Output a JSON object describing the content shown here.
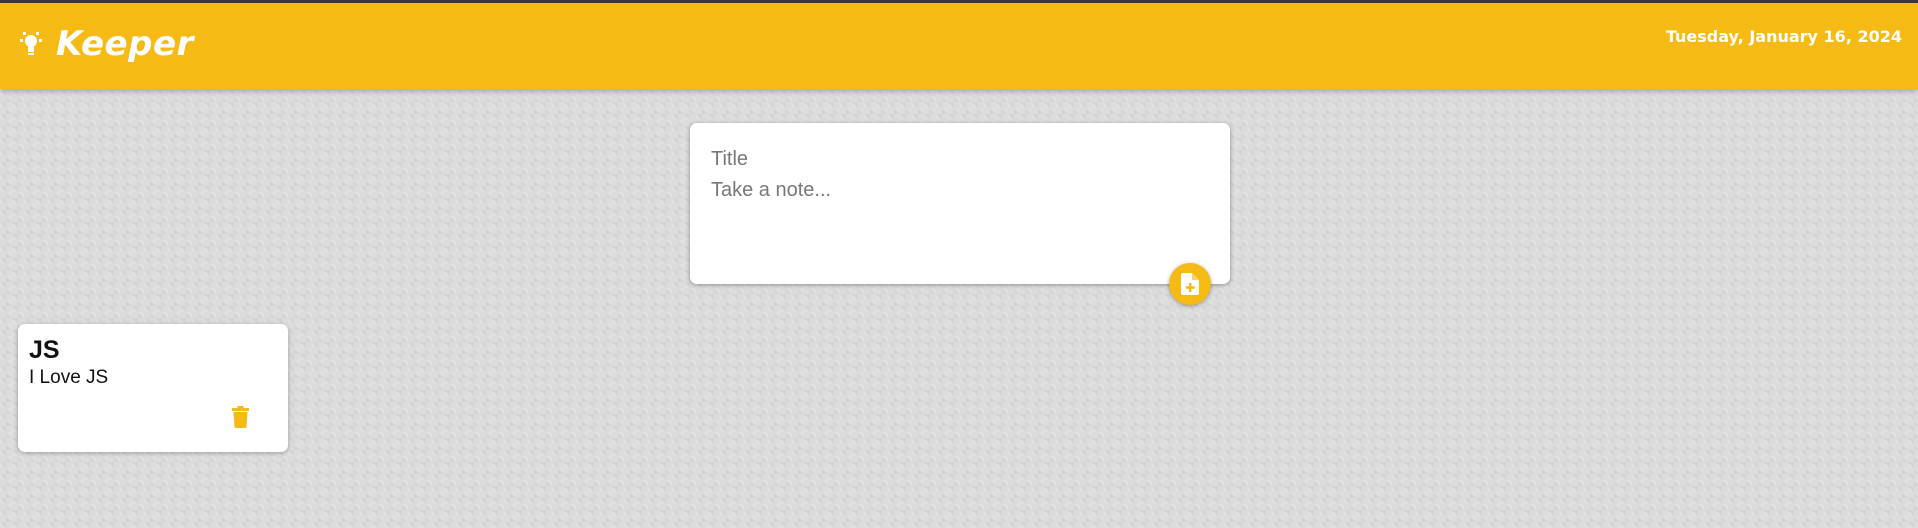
{
  "header": {
    "app_title": "Keeper",
    "logo_icon": "lightbulb-icon",
    "date": "Tuesday, January 16, 2024"
  },
  "create_note": {
    "title_placeholder": "Title",
    "content_placeholder": "Take a note...",
    "title_value": "",
    "content_value": "",
    "add_button_icon": "note-add-icon"
  },
  "notes": [
    {
      "title": "JS",
      "content": "I Love JS",
      "delete_icon": "trash-icon"
    }
  ],
  "colors": {
    "accent": "#f5ba13",
    "background": "#dcdcdc",
    "card": "#ffffff"
  }
}
